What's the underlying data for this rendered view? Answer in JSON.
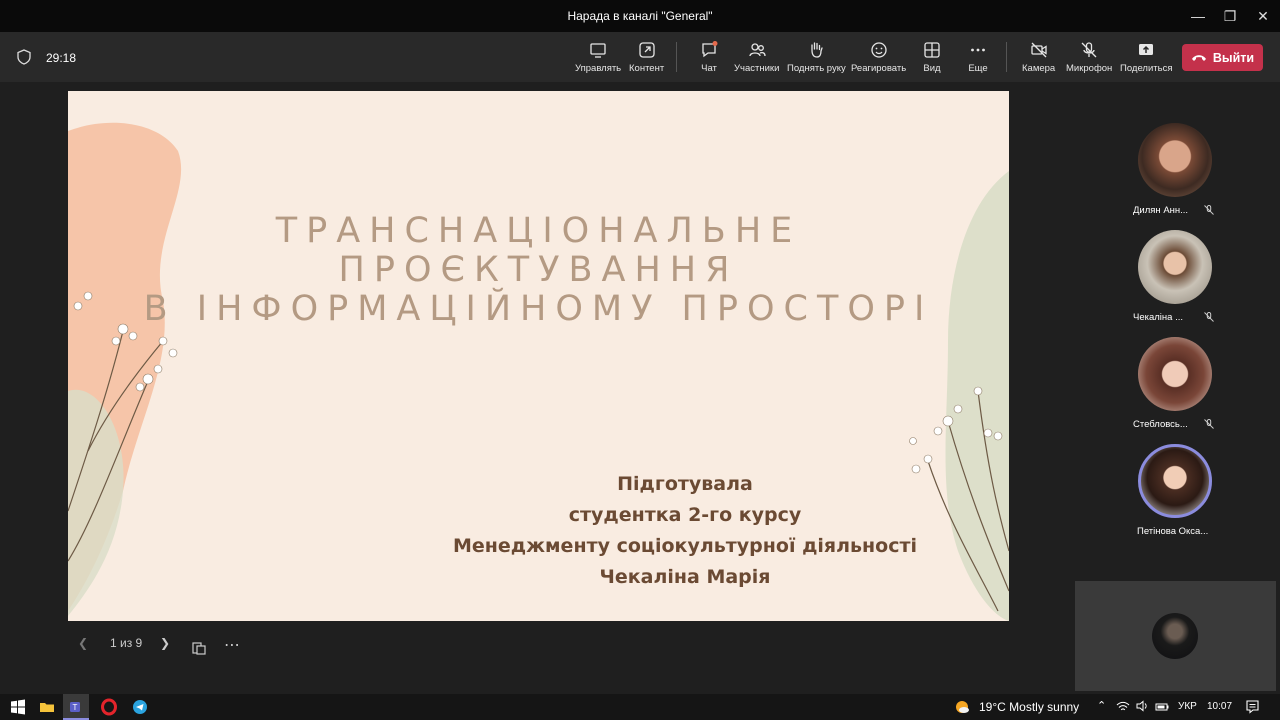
{
  "window": {
    "title": "Нарада в каналі \"General\""
  },
  "toolbar": {
    "timer": "29:18",
    "buttons": [
      {
        "label": "Управлять",
        "icon": "share-screen-icon"
      },
      {
        "label": "Контент",
        "icon": "content-icon"
      },
      {
        "label": "Чат",
        "icon": "chat-icon"
      },
      {
        "label": "Участники",
        "icon": "participants-icon"
      },
      {
        "label": "Поднять руку",
        "icon": "raise-hand-icon"
      },
      {
        "label": "Реагировать",
        "icon": "smiley-icon"
      },
      {
        "label": "Вид",
        "icon": "grid-view-icon"
      },
      {
        "label": "Еще",
        "icon": "more-icon"
      },
      {
        "label": "Камера",
        "icon": "camera-off-icon"
      },
      {
        "label": "Микрофон",
        "icon": "mic-off-icon"
      },
      {
        "label": "Поделиться",
        "icon": "share-icon"
      }
    ],
    "leave_label": "Выйти"
  },
  "slide": {
    "title_lines": [
      "ТРАНСНАЦІОНАЛЬНЕ",
      "ПРОЄКТУВАННЯ",
      "В ІНФОРМАЦІЙНОМУ ПРОСТОРІ"
    ],
    "subtitle_lines": [
      "Підготувала",
      "студентка 2-го курсу",
      "Менеджменту соціокультурної діяльності",
      "Чекаліна Марія"
    ]
  },
  "slide_nav": {
    "page": "1 из 9"
  },
  "participants": [
    {
      "name": "Дилян Анн..."
    },
    {
      "name": "Чекаліна ..."
    },
    {
      "name": "Стебловсь..."
    },
    {
      "name": "Петінова Окса..."
    }
  ],
  "taskbar": {
    "weather": "19°C  Mostly sunny",
    "lang": "УКР",
    "time": "10:07"
  },
  "colors": {
    "leave": "#c4314b",
    "slide_bg": "#f9ece1",
    "title": "#b49a83",
    "subtitle": "#6b4a33"
  }
}
